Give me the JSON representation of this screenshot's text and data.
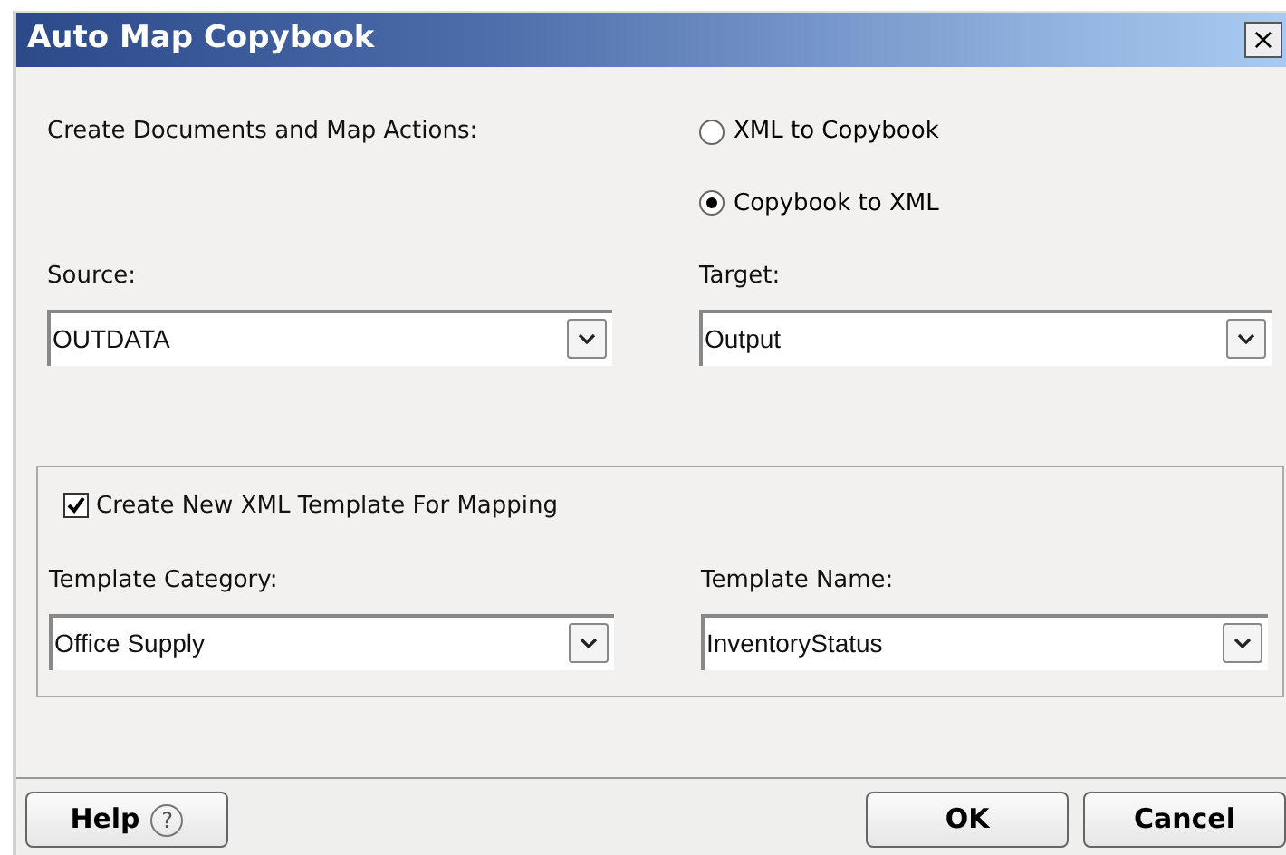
{
  "window": {
    "title": "Auto Map Copybook",
    "close": "×"
  },
  "actions": {
    "label": "Create Documents and Map Actions:",
    "options": [
      {
        "label": "XML to Copybook",
        "selected": false
      },
      {
        "label": "Copybook to XML",
        "selected": true
      }
    ]
  },
  "source": {
    "label": "Source:",
    "value": "OUTDATA"
  },
  "target": {
    "label": "Target:",
    "value": "Output"
  },
  "template": {
    "checkbox": {
      "label": "Create New XML Template For Mapping",
      "checked": true
    },
    "category": {
      "label": "Template Category:",
      "value": "Office Supply"
    },
    "name": {
      "label": "Template Name:",
      "value": "InventoryStatus"
    }
  },
  "buttons": [
    {
      "kind": "help",
      "label": "Help",
      "icon": "?"
    },
    {
      "kind": "ok",
      "label": "OK"
    },
    {
      "kind": "cancel",
      "label": "Cancel"
    }
  ]
}
